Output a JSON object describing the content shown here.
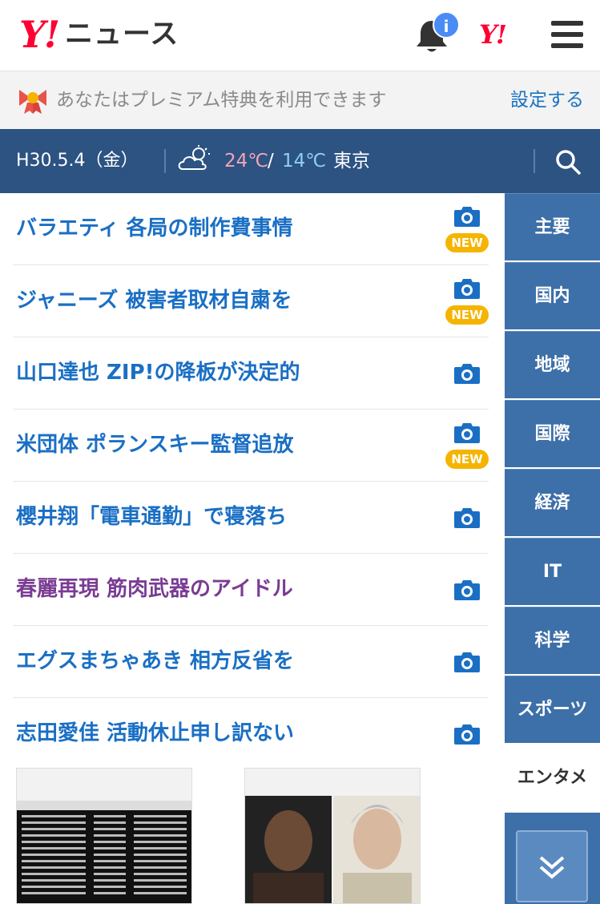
{
  "header": {
    "logo_y": "Y!",
    "logo_text": "ニュース",
    "notification_badge": "i",
    "yahoo_mark": "Y!"
  },
  "premium": {
    "text": "あなたはプレミアム特典を利用できます",
    "link": "設定する"
  },
  "info_bar": {
    "date": "H30.5.4（金）",
    "weather_icon": "cloudy-icon",
    "temp_high": "24℃",
    "temp_separator": "/",
    "temp_low": "14℃",
    "city": "東京",
    "temp_high_color": "#f3a4b4",
    "temp_low_color": "#8fd0f2",
    "bar_color": "#2c5382"
  },
  "news": [
    {
      "title": "バラエティ 各局の制作費事情",
      "new": true,
      "visited": false
    },
    {
      "title": "ジャニーズ 被害者取材自粛を",
      "new": true,
      "visited": false
    },
    {
      "title": "山口達也 ZIP!の降板が決定的",
      "new": false,
      "visited": false
    },
    {
      "title": "米団体 ポランスキー監督追放",
      "new": true,
      "visited": false
    },
    {
      "title": "櫻井翔「電車通勤」で寝落ち",
      "new": false,
      "visited": false
    },
    {
      "title": "春麗再現 筋肉武器のアイドル",
      "new": false,
      "visited": true
    },
    {
      "title": "エグスまちゃあき 相方反省を",
      "new": false,
      "visited": false
    },
    {
      "title": "志田愛佳 活動休止申し訳ない",
      "new": false,
      "visited": false
    }
  ],
  "new_badge_label": "NEW",
  "categories": [
    {
      "label": "主要",
      "active": false
    },
    {
      "label": "国内",
      "active": false
    },
    {
      "label": "地域",
      "active": false
    },
    {
      "label": "国際",
      "active": false
    },
    {
      "label": "経済",
      "active": false
    },
    {
      "label": "IT",
      "active": false
    },
    {
      "label": "科学",
      "active": false
    },
    {
      "label": "スポーツ",
      "active": false
    },
    {
      "label": "エンタメ",
      "active": true
    }
  ],
  "colors": {
    "link_blue": "#1a6fc4",
    "visited_purple": "#7a3c93",
    "new_badge": "#f5b400",
    "category_blue": "#3d6fa8",
    "brand_red": "#ff0033"
  }
}
